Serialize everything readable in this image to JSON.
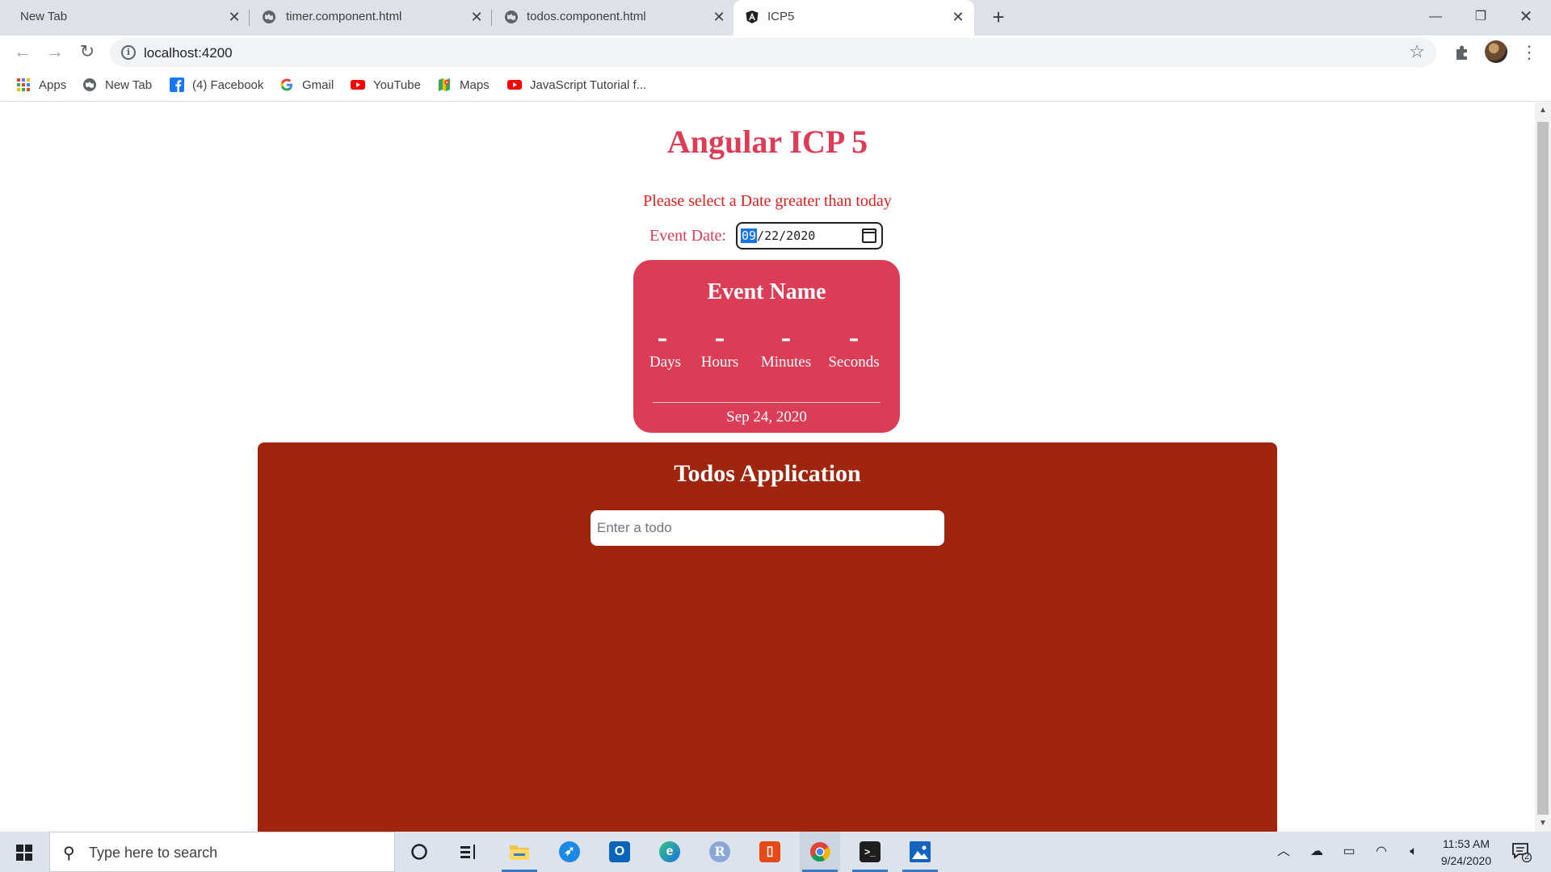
{
  "browser": {
    "tabs": [
      {
        "title": "New Tab",
        "active": false
      },
      {
        "title": "timer.component.html",
        "active": false
      },
      {
        "title": "todos.component.html",
        "active": false
      },
      {
        "title": "ICP5",
        "active": true
      }
    ],
    "url": "localhost:4200",
    "bookmarks": [
      {
        "label": "Apps",
        "icon": "apps-grid-icon"
      },
      {
        "label": "New Tab",
        "icon": "globe-icon"
      },
      {
        "label": "(4) Facebook",
        "icon": "facebook-icon"
      },
      {
        "label": "Gmail",
        "icon": "google-icon"
      },
      {
        "label": "YouTube",
        "icon": "youtube-icon"
      },
      {
        "label": "Maps",
        "icon": "maps-icon"
      },
      {
        "label": "JavaScript Tutorial f...",
        "icon": "youtube-icon"
      }
    ]
  },
  "page": {
    "title": "Angular ICP 5",
    "hint": "Please select a Date greater than today",
    "date_label": "Event Date:",
    "date_value": {
      "month": "09",
      "day": "22",
      "year": "2020"
    },
    "timer": {
      "event_name": "Event Name",
      "units": [
        {
          "value": "-",
          "label": "Days"
        },
        {
          "value": "-",
          "label": "Hours"
        },
        {
          "value": "-",
          "label": "Minutes"
        },
        {
          "value": "-",
          "label": "Seconds"
        }
      ],
      "event_date": "Sep 24, 2020"
    },
    "todos": {
      "title": "Todos Application",
      "placeholder": "Enter a todo"
    }
  },
  "taskbar": {
    "search_placeholder": "Type here to search",
    "time": "11:53 AM",
    "date": "9/24/2020",
    "notification_count": "2"
  },
  "colors": {
    "accent": "#dc3d56",
    "hint_red": "#e0201e",
    "todos_bg": "#a0250f"
  }
}
